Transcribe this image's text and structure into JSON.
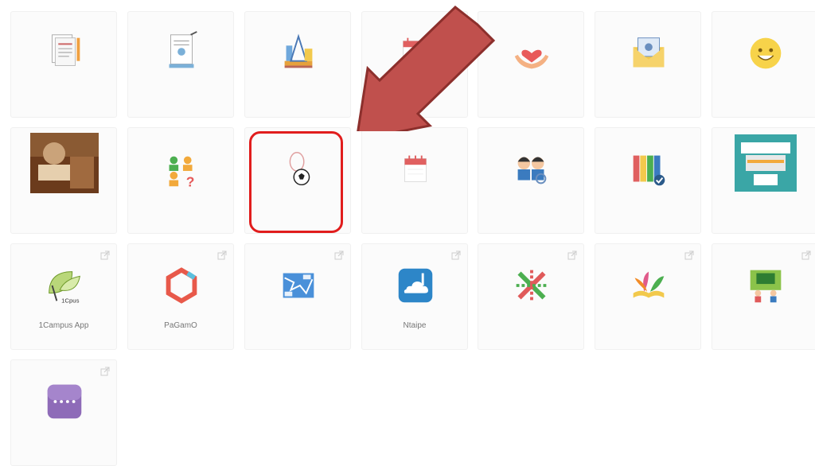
{
  "tiles": [
    {
      "label": "",
      "icon": "document-pen-icon"
    },
    {
      "label": "",
      "icon": "certificate-icon"
    },
    {
      "label": "",
      "icon": "drafting-tools-icon"
    },
    {
      "label": "",
      "icon": "calendar-icon"
    },
    {
      "label": "",
      "icon": "heart-hands-icon"
    },
    {
      "label": "",
      "icon": "email-envelope-icon"
    },
    {
      "label": "",
      "icon": "smiley-face-icon"
    },
    {
      "label": "",
      "icon": "photo-thumbnail-icon"
    },
    {
      "label": "",
      "icon": "people-question-icon"
    },
    {
      "label": "",
      "icon": "soccer-ball-icon"
    },
    {
      "label": "",
      "icon": "calendar-icon"
    },
    {
      "label": "",
      "icon": "family-icon"
    },
    {
      "label": "",
      "icon": "binders-check-icon"
    },
    {
      "label": "",
      "icon": "printer-icon"
    },
    {
      "label": "1Campus App",
      "icon": "leaf-icon"
    },
    {
      "label": "PaGamO",
      "icon": "hexagon-icon"
    },
    {
      "label": "",
      "icon": "map-icon"
    },
    {
      "label": "Ntaipe",
      "icon": "cloud-icon"
    },
    {
      "label": "",
      "icon": "star-grid-icon"
    },
    {
      "label": "",
      "icon": "book-leaves-icon"
    },
    {
      "label": "",
      "icon": "classroom-icon"
    },
    {
      "label": "",
      "icon": "app-dots-icon"
    }
  ],
  "highlight_color": "#e11d1d",
  "arrow_color": "#c0504d"
}
